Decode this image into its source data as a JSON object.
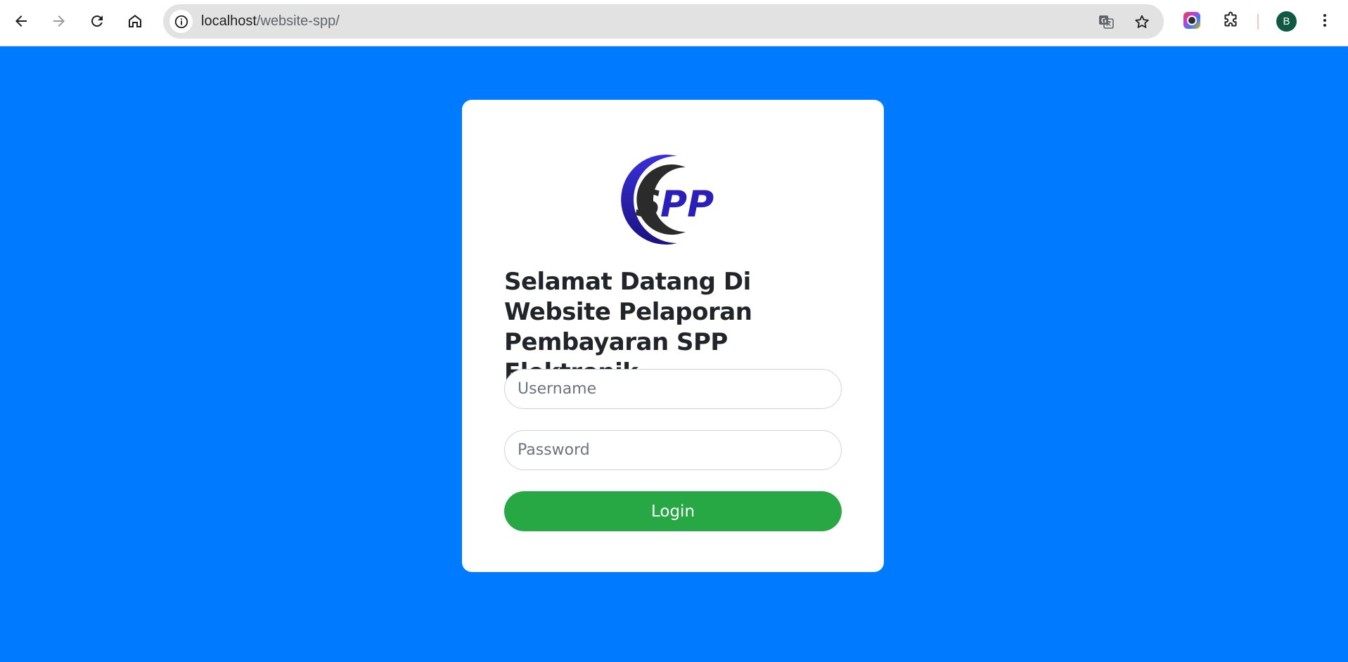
{
  "browser": {
    "url_host": "localhost",
    "url_path": "/website-spp/",
    "profile_initial": "B",
    "icons": {
      "back": "arrow-left-icon",
      "forward": "arrow-right-icon",
      "reload": "reload-icon",
      "home": "home-icon",
      "site_info": "info-icon",
      "translate": "translate-icon",
      "bookmark": "star-icon",
      "extension_color": "color-picker-icon",
      "extensions": "puzzle-icon",
      "menu": "kebab-menu-icon"
    }
  },
  "login": {
    "logo_text": "SPP",
    "title": "Selamat Datang Di Website Pelaporan Pembayaran SPP Elektronik",
    "username_placeholder": "Username",
    "password_placeholder": "Password",
    "login_label": "Login"
  },
  "colors": {
    "page_bg": "#007bff",
    "button_bg": "#28a745",
    "logo_blue": "#2a1fb8",
    "logo_dark": "#2b2b2b"
  }
}
